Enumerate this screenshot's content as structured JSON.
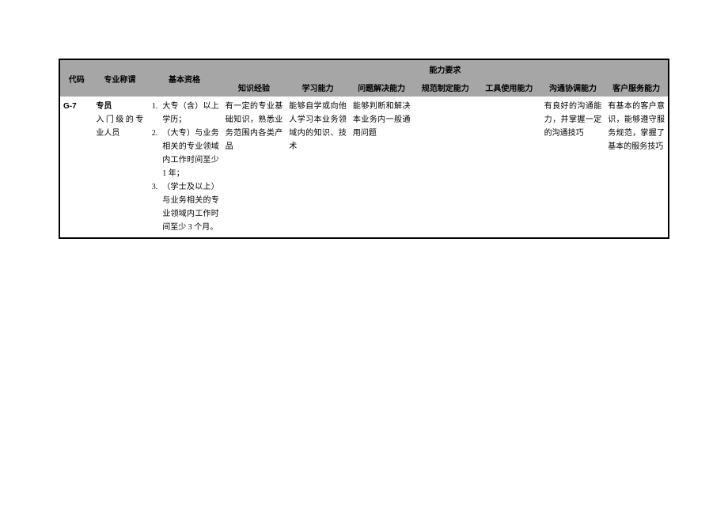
{
  "headers": {
    "code": "代码",
    "title": "专业称谓",
    "qualification": "基本资格",
    "ability_group": "能力要求",
    "knowledge": "知识经验",
    "learning": "学习能力",
    "problem": "问题解决能力",
    "norm": "规范制定能力",
    "tool": "工具使用能力",
    "communication": "沟通协调能力",
    "customer": "客户服务能力"
  },
  "row": {
    "code": "G-7",
    "title_main": "专员",
    "title_sub": "入门级的专业人员",
    "qualifications": [
      {
        "n": "1.",
        "t": "大专（含）以上学历；"
      },
      {
        "n": "2.",
        "t": "（大专）与业务相关的专业领域内工作时间至少 1 年；"
      },
      {
        "n": "3.",
        "t": "（学士及以上）与业务相关的专业领域内工作时间至少 3 个月。"
      }
    ],
    "knowledge": "有一定的专业基础知识，熟悉业务范围内各类产品",
    "learning": "能够自学或向他人学习本业务领域内的知识、技术",
    "problem": "能够判断和解决本业务内一般通用问题",
    "norm": "",
    "tool": "",
    "communication": "有良好的沟通能力，并掌握一定的沟通技巧",
    "customer": "有基本的客户意识，能够遵守服务规范，掌握了基本的服务技巧"
  }
}
